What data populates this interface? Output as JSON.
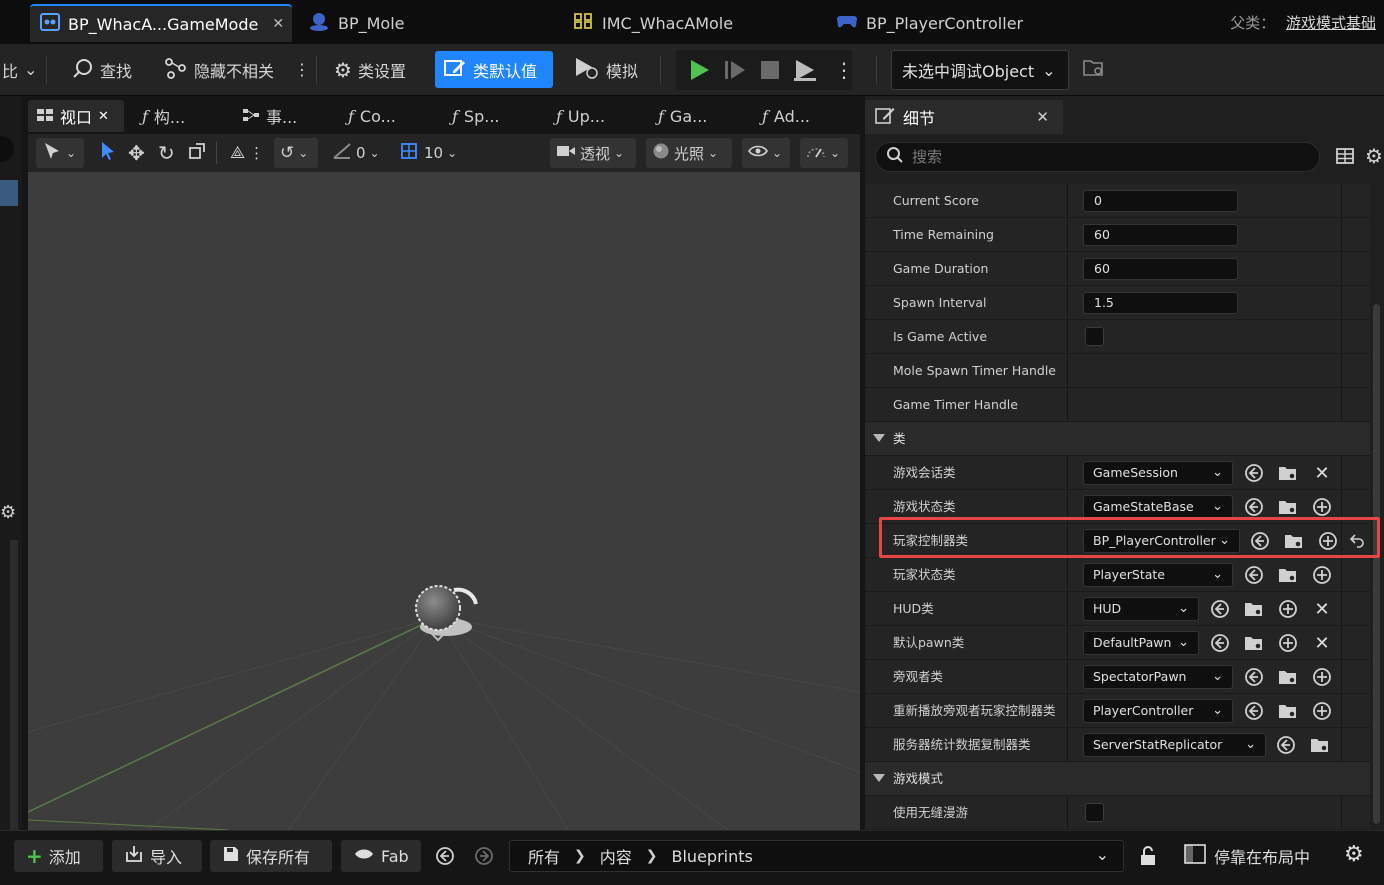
{
  "tabs": [
    {
      "label": "BP_WhacA...GameMode",
      "icon": "blueprint-icon",
      "active": true
    },
    {
      "label": "BP_Mole",
      "icon": "pawn-icon"
    },
    {
      "label": "IMC_WhacAMole",
      "icon": "input-mapping-icon"
    },
    {
      "label": "BP_PlayerController",
      "icon": "controller-icon"
    }
  ],
  "parent_class": {
    "label": "父类：",
    "value": "游戏模式基础"
  },
  "toolbar": {
    "left_clip": "比",
    "find": "查找",
    "hide_unrelated": "隐藏不相关",
    "class_settings": "类设置",
    "class_defaults": "类默认值",
    "simulate": "模拟",
    "debug_object": "未选中调试Object"
  },
  "panel_tabs": [
    {
      "label": "视口",
      "icon": "viewport-icon",
      "active": true
    },
    {
      "label": "构...",
      "icon": "function-icon"
    },
    {
      "label": "事...",
      "icon": "event-graph-icon"
    },
    {
      "label": "Co...",
      "icon": "function-icon"
    },
    {
      "label": "Sp...",
      "icon": "function-icon"
    },
    {
      "label": "Up...",
      "icon": "function-icon"
    },
    {
      "label": "Ga...",
      "icon": "function-icon"
    },
    {
      "label": "Ad...",
      "icon": "function-icon"
    }
  ],
  "viewport_toolbar": {
    "rotation_snap": "0",
    "grid_size": "10",
    "view_mode": "透视",
    "lighting": "光照"
  },
  "details": {
    "tab_label": "细节",
    "search_placeholder": "搜索",
    "properties": [
      {
        "name": "Current Score",
        "value": "0",
        "type": "number"
      },
      {
        "name": "Time Remaining",
        "value": "60",
        "type": "number"
      },
      {
        "name": "Game Duration",
        "value": "60",
        "type": "number"
      },
      {
        "name": "Spawn Interval",
        "value": "1.5",
        "type": "number"
      },
      {
        "name": "Is Game Active",
        "type": "checkbox",
        "checked": false
      },
      {
        "name": "Mole Spawn Timer Handle",
        "type": "empty"
      },
      {
        "name": "Game Timer Handle",
        "type": "empty"
      }
    ],
    "class_category": "类",
    "class_props": [
      {
        "name": "游戏会话类",
        "value": "GameSession",
        "clear": true
      },
      {
        "name": "游戏状态类",
        "value": "GameStateBase",
        "clear": false
      },
      {
        "name": "玩家控制器类",
        "value": "BP_PlayerController",
        "clear": false,
        "reset": true,
        "highlighted": true
      },
      {
        "name": "玩家状态类",
        "value": "PlayerState",
        "clear": false
      },
      {
        "name": "HUD类",
        "value": "HUD",
        "clear": true
      },
      {
        "name": "默认pawn类",
        "value": "DefaultPawn",
        "clear": true
      },
      {
        "name": "旁观者类",
        "value": "SpectatorPawn",
        "clear": false
      },
      {
        "name": "重新播放旁观者玩家控制器类",
        "value": "PlayerController",
        "clear": false
      },
      {
        "name": "服务器统计数据复制器类",
        "value": "ServerStatReplicator",
        "clear": false
      }
    ],
    "gamemode_category": "游戏模式",
    "gamemode_props": [
      {
        "name": "使用无缝漫游",
        "type": "checkbox",
        "checked": false
      }
    ]
  },
  "bottombar": {
    "add": "添加",
    "import": "导入",
    "save_all": "保存所有",
    "fab": "Fab",
    "path": [
      "所有",
      "内容",
      "Blueprints"
    ],
    "dock": "停靠在布局中"
  },
  "colors": {
    "accent": "#1f86ff",
    "highlight": "#e84545",
    "play_green": "#4fc24f"
  }
}
